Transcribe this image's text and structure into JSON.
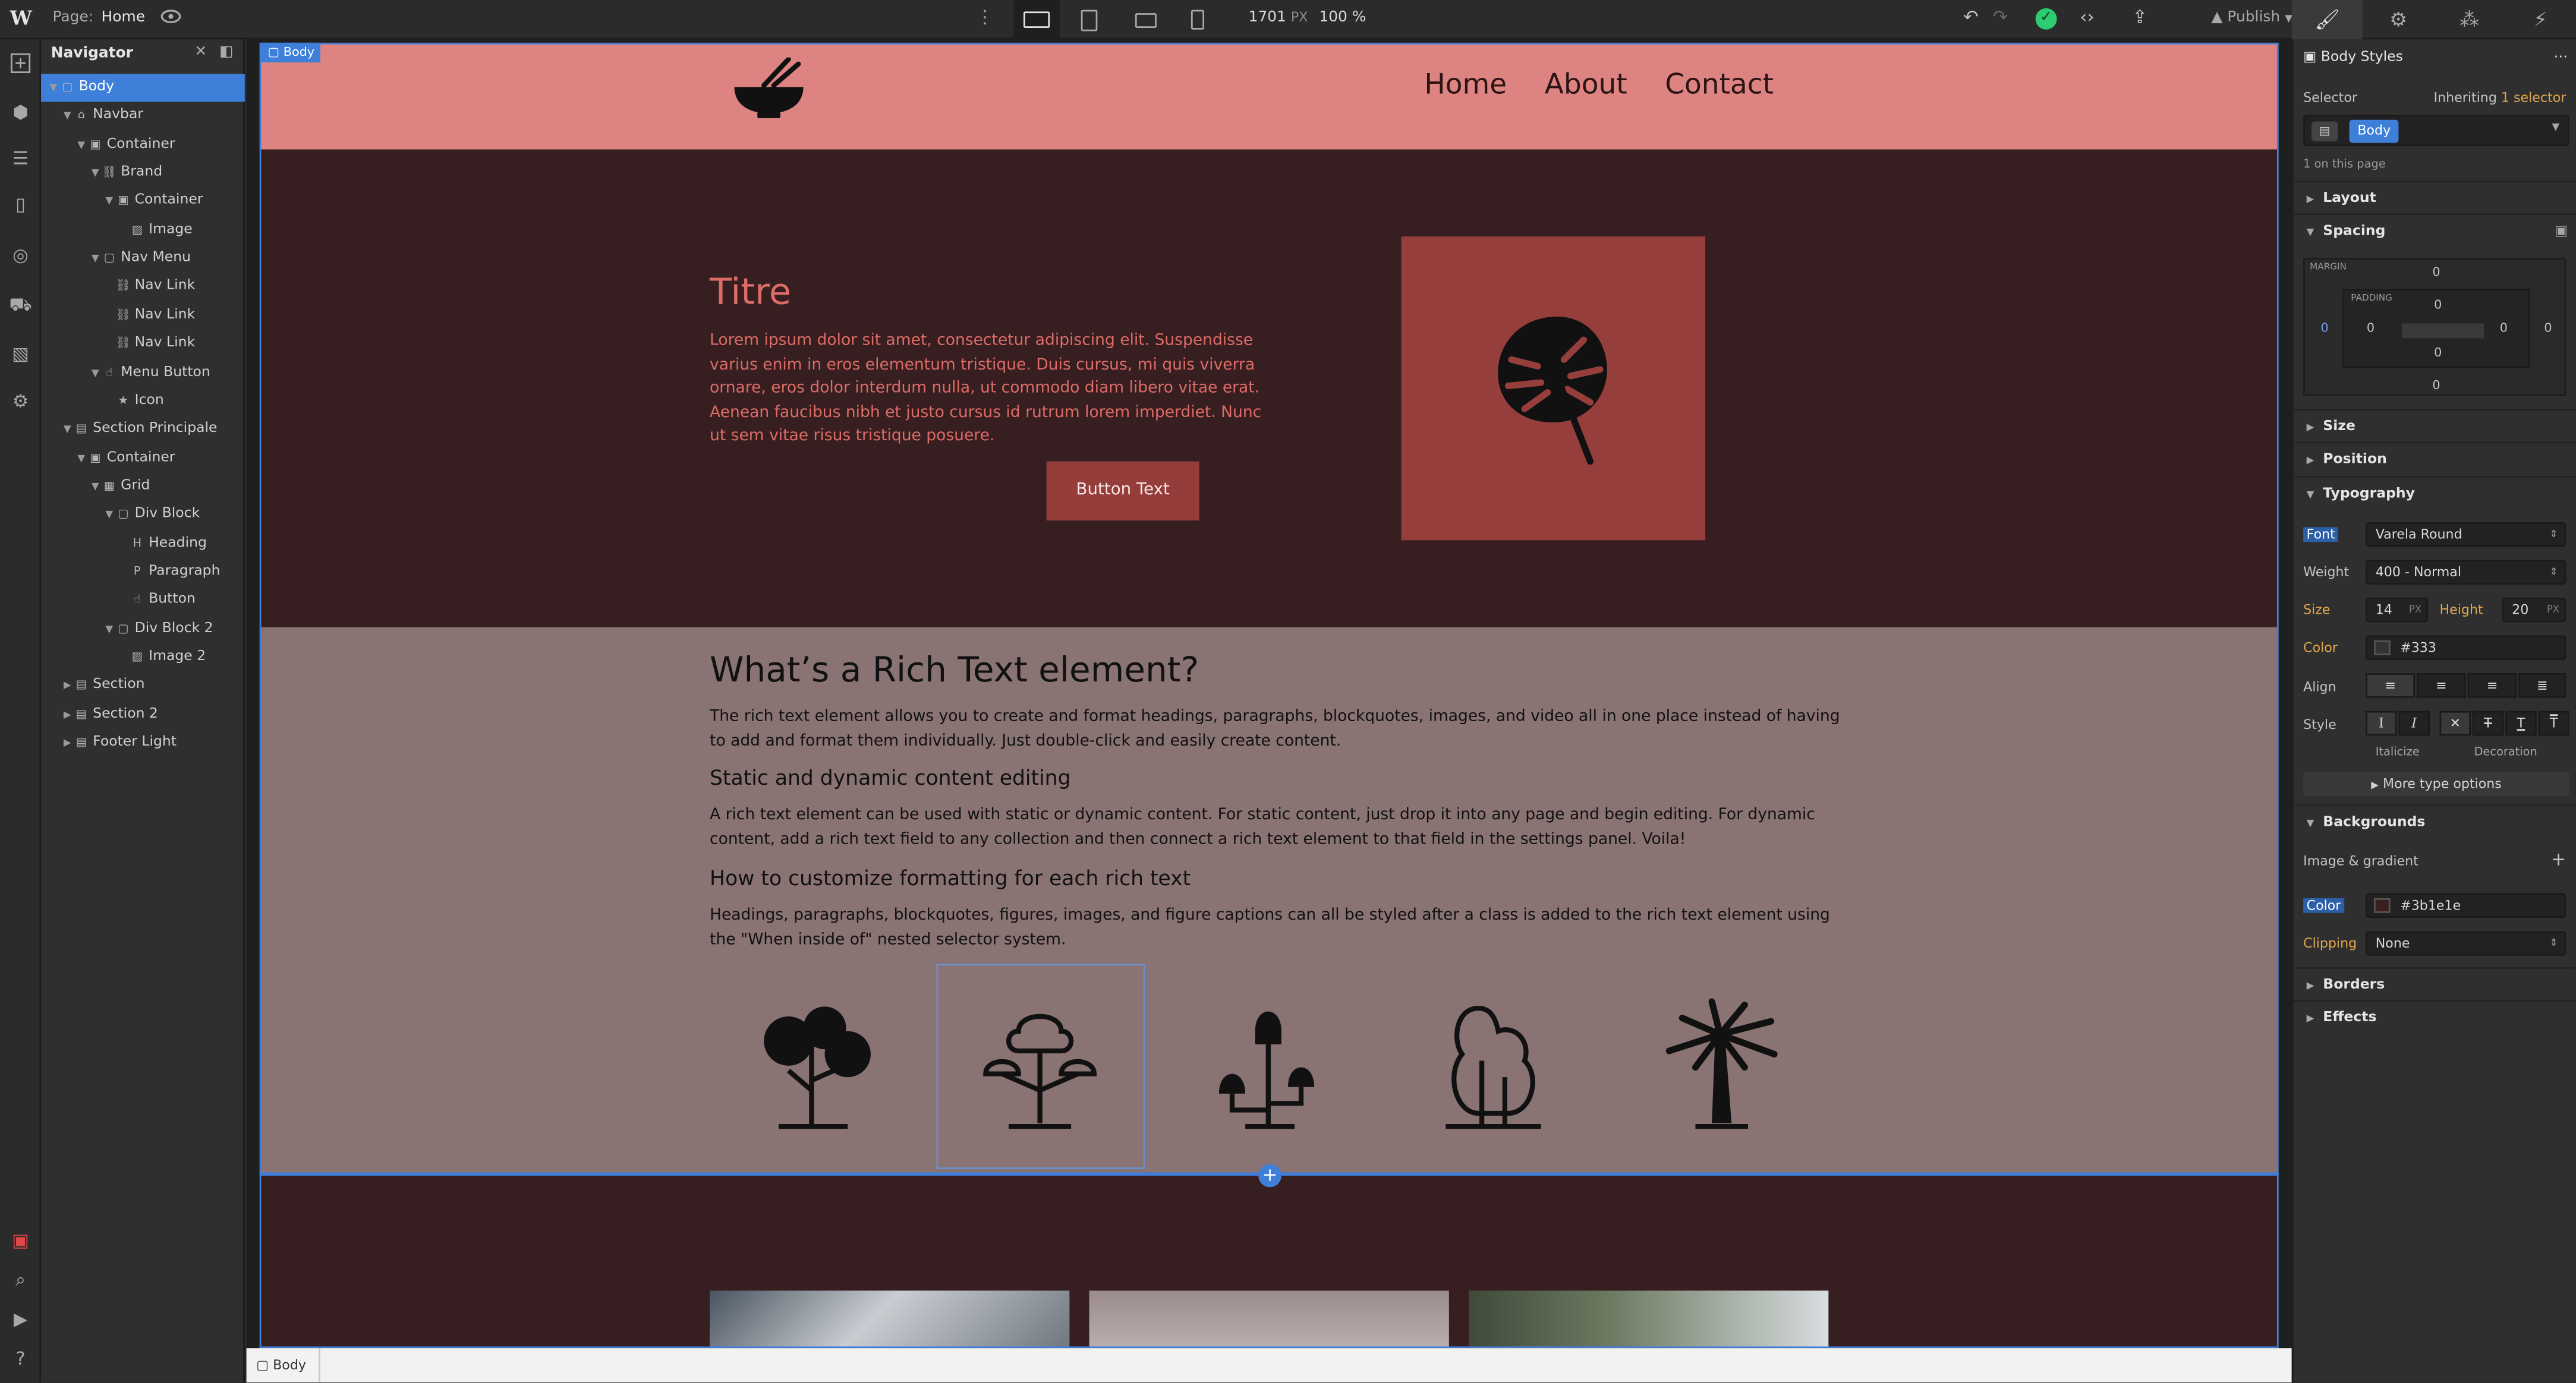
{
  "topbar": {
    "logo": "W",
    "page_label": "Page:",
    "page_name": "Home",
    "width_value": "1701",
    "width_unit": "PX",
    "zoom": "100 %",
    "publish_label": "Publish",
    "status": "saved"
  },
  "left_rail": {
    "icons": [
      "add-icon",
      "cube-icon",
      "layers-icon",
      "page-icon",
      "cms-icon",
      "ecommerce-icon",
      "assets-icon",
      "settings-icon",
      "audit-icon",
      "search-icon",
      "video-icon",
      "help-icon"
    ]
  },
  "navigator": {
    "title": "Navigator",
    "items": [
      {
        "label": "Body",
        "depth": 0,
        "icon": "▢",
        "selected": true
      },
      {
        "label": "Navbar",
        "depth": 1,
        "icon": "⌂"
      },
      {
        "label": "Container",
        "depth": 2,
        "icon": "▣"
      },
      {
        "label": "Brand",
        "depth": 3,
        "icon": "⛓"
      },
      {
        "label": "Container",
        "depth": 4,
        "icon": "▣"
      },
      {
        "label": "Image",
        "depth": 5,
        "icon": "▨"
      },
      {
        "label": "Nav Menu",
        "depth": 3,
        "icon": "▢"
      },
      {
        "label": "Nav Link",
        "depth": 4,
        "icon": "⛓"
      },
      {
        "label": "Nav Link",
        "depth": 4,
        "icon": "⛓"
      },
      {
        "label": "Nav Link",
        "depth": 4,
        "icon": "⛓"
      },
      {
        "label": "Menu Button",
        "depth": 3,
        "icon": "☝"
      },
      {
        "label": "Icon",
        "depth": 4,
        "icon": "★"
      },
      {
        "label": "Section Principale",
        "depth": 1,
        "icon": "▤"
      },
      {
        "label": "Container",
        "depth": 2,
        "icon": "▣"
      },
      {
        "label": "Grid",
        "depth": 3,
        "icon": "▦"
      },
      {
        "label": "Div Block",
        "depth": 4,
        "icon": "▢"
      },
      {
        "label": "Heading",
        "depth": 5,
        "icon": "H"
      },
      {
        "label": "Paragraph",
        "depth": 5,
        "icon": "P"
      },
      {
        "label": "Button",
        "depth": 5,
        "icon": "☝"
      },
      {
        "label": "Div Block 2",
        "depth": 4,
        "icon": "▢"
      },
      {
        "label": "Image 2",
        "depth": 5,
        "icon": "▨"
      },
      {
        "label": "Section",
        "depth": 1,
        "icon": "▤"
      },
      {
        "label": "Section 2",
        "depth": 1,
        "icon": "▤"
      },
      {
        "label": "Footer Light",
        "depth": 1,
        "icon": "▤"
      }
    ]
  },
  "canvas": {
    "body_tag": "Body",
    "navbar": {
      "links": [
        "Home",
        "About",
        "Contact"
      ],
      "brand_icon": "bowl-chopsticks-icon"
    },
    "hero": {
      "heading": "Titre",
      "paragraph": "Lorem ipsum dolor sit amet, consectetur adipiscing elit. Suspendisse varius enim in eros elementum tristique. Duis cursus, mi quis viverra ornare, eros dolor interdum nulla, ut commodo diam libero vitae erat. Aenean faucibus nibh et justo cursus id rutrum lorem imperdiet. Nunc ut sem vitae risus tristique posuere.",
      "button": "Button Text",
      "image_icon": "monstera-leaf-icon"
    },
    "rich_text": {
      "h2": "What’s a Rich Text element?",
      "p1": "The rich text element allows you to create and format headings, paragraphs, blockquotes, images, and video all in one place instead of having to add and format them individually. Just double-click and easily create content.",
      "h3a": "Static and dynamic content editing",
      "p2": "A rich text element can be used with static or dynamic content. For static content, just drop it into any page and begin editing. For dynamic content, add a rich text field to any collection and then connect a rich text element to that field in the settings panel. Voila!",
      "h3b": "How to customize formatting for each rich text",
      "p3": "Headings, paragraphs, blockquotes, figures, images, and figure captions can all be styled after a class is added to the rich text element using the \"When inside of\" nested selector system.",
      "trees": [
        "tree-round-icon",
        "bonsai-tree-icon",
        "mushroom-tree-icon",
        "bush-tree-icon",
        "palm-tree-icon"
      ]
    }
  },
  "breadcrumb": {
    "label": "Body"
  },
  "style_panel": {
    "header": "Body Styles",
    "selector_label": "Selector",
    "inheriting_prefix": "Inheriting",
    "inheriting_count": "1 selector",
    "selector_chip": "Body",
    "on_page": "1 on this page",
    "sections": {
      "layout": "Layout",
      "spacing": "Spacing",
      "size": "Size",
      "position": "Position",
      "typography": "Typography",
      "backgrounds": "Backgrounds",
      "borders": "Borders",
      "effects": "Effects"
    },
    "spacing": {
      "margin_label": "MARGIN",
      "padding_label": "PADDING",
      "margin_top": "0",
      "margin_right": "0",
      "margin_bottom": "0",
      "margin_left": "0",
      "padding_top": "0",
      "padding_right": "0",
      "padding_bottom": "0",
      "padding_left": "0"
    },
    "typography": {
      "font_label": "Font",
      "font": "Varela Round",
      "weight_label": "Weight",
      "weight": "400 - Normal",
      "size_label": "Size",
      "size": "14",
      "size_unit": "PX",
      "height_label": "Height",
      "height": "20",
      "height_unit": "PX",
      "color_label": "Color",
      "color": "#333",
      "align_label": "Align",
      "style_label": "Style",
      "italicize_label": "Italicize",
      "decoration_label": "Decoration",
      "more": "More type options"
    },
    "backgrounds": {
      "image_gradient": "Image & gradient",
      "color_label": "Color",
      "color": "#3b1e1e",
      "clipping_label": "Clipping",
      "clipping": "None"
    }
  }
}
